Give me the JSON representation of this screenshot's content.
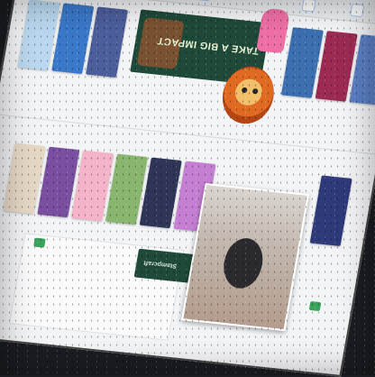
{
  "banners": {
    "main_caption": "TAKE A BIG IMPACT",
    "small_caption": "Stampcraft"
  },
  "toolbar": {
    "chips": [
      "",
      "",
      "",
      "",
      "",
      ""
    ]
  },
  "thumbnail_colors": {
    "row1": [
      "#b9d7ee",
      "#3a78c9",
      "#4c5e9c",
      "#f2c06b",
      "#3b6fb0",
      "#9c2a55",
      "#5b7fc4",
      "#7f6aa9"
    ],
    "row2": [
      "#e6d7c5",
      "#7a4fa1",
      "#f4b3c9",
      "#89b66e",
      "#2f3556",
      "#c47fd3",
      "#2f3a7b",
      "#d6c7bf"
    ]
  },
  "accent": {
    "green": "#1f4a3a",
    "button": "#3aa35b",
    "chip_border": "#a9c4ef"
  },
  "icons": [
    "sticker-lion-icon",
    "green-action-icon"
  ]
}
